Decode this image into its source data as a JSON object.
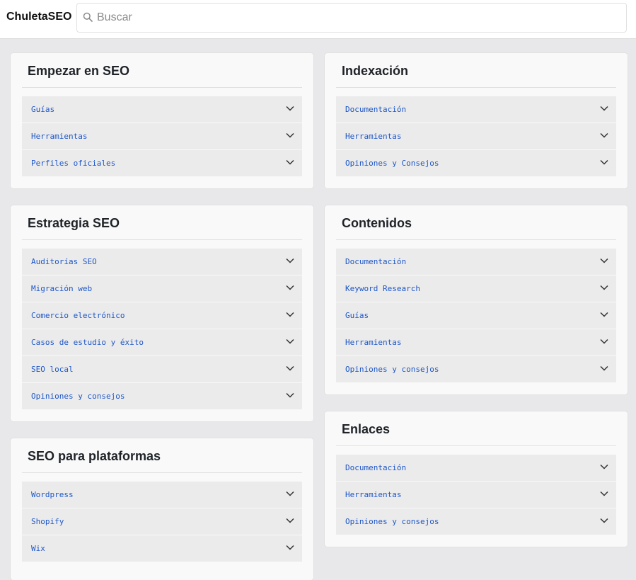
{
  "header": {
    "brand": "ChuletaSEO",
    "search_placeholder": "Buscar"
  },
  "colors": {
    "link": "#1e57c8",
    "card_bg": "#f9f9f9",
    "item_bg": "#ebebeb",
    "page_bg": "#e8e8ea"
  },
  "sections": {
    "empezar": {
      "title": "Empezar en SEO",
      "items": [
        "Guías",
        "Herramientas",
        "Perfiles oficiales"
      ]
    },
    "indexacion": {
      "title": "Indexación",
      "items": [
        "Documentación",
        "Herramientas",
        "Opiniones y Consejos"
      ]
    },
    "estrategia": {
      "title": "Estrategia SEO",
      "items": [
        "Auditorías SEO",
        "Migración web",
        "Comercio electrónico",
        "Casos de estudio y éxito",
        "SEO local",
        "Opiniones y consejos"
      ]
    },
    "contenidos": {
      "title": "Contenidos",
      "items": [
        "Documentación",
        "Keyword Research",
        "Guías",
        "Herramientas",
        "Opiniones y consejos"
      ]
    },
    "plataformas": {
      "title": "SEO para plataformas",
      "items": [
        "Wordpress",
        "Shopify",
        "Wix"
      ]
    },
    "enlaces": {
      "title": "Enlaces",
      "items": [
        "Documentación",
        "Herramientas",
        "Opiniones y consejos"
      ]
    }
  }
}
